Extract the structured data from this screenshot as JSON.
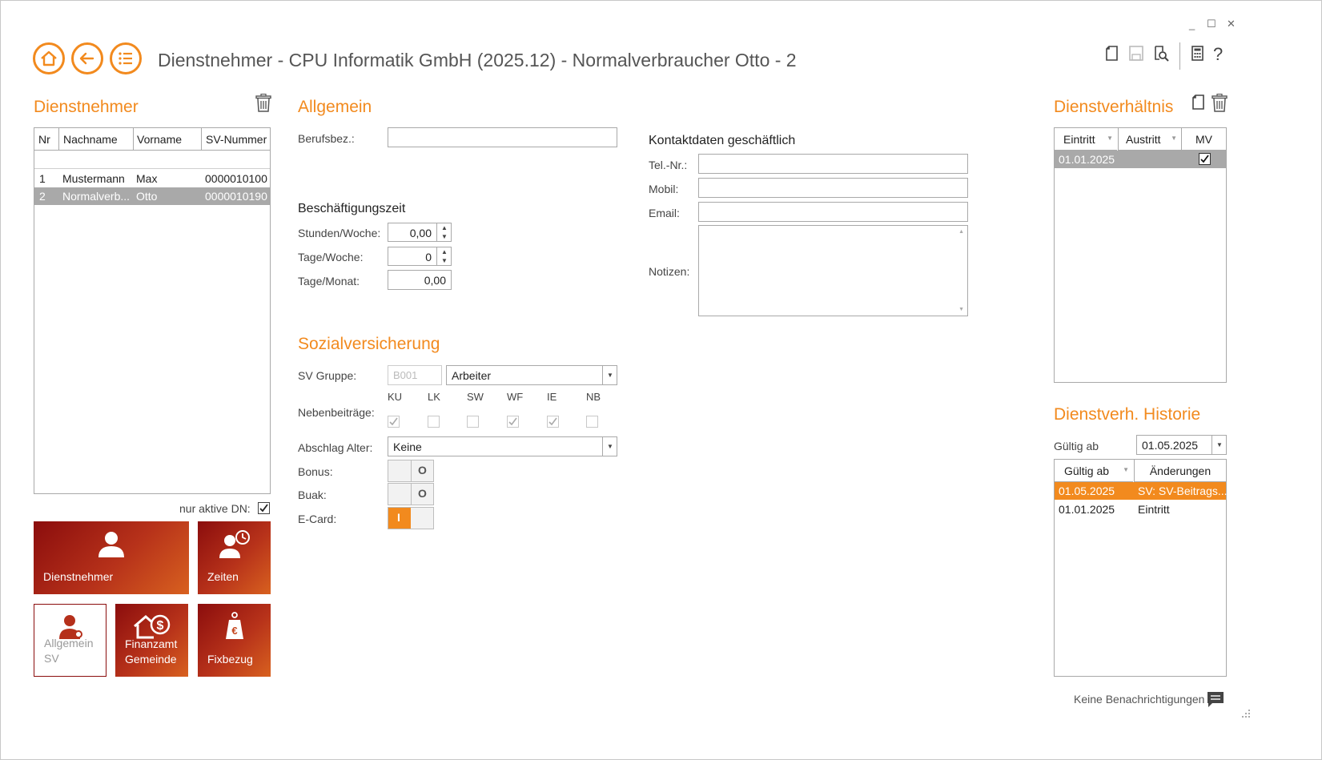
{
  "window": {
    "title": "Dienstnehmer - CPU Informatik GmbH (2025.12) - Normalverbraucher Otto - 2",
    "controls": [
      "_",
      "☐",
      "✕"
    ]
  },
  "toolbar_icons": [
    "new-document-icon",
    "save-icon",
    "search-document-icon",
    "calculator-icon",
    "help-icon"
  ],
  "nav_icons": [
    "home-icon",
    "back-icon",
    "list-icon"
  ],
  "dienstnehmer": {
    "title": "Dienstnehmer",
    "columns": [
      "Nr",
      "Nachname",
      "Vorname",
      "SV-Nummer"
    ],
    "rows": [
      {
        "nr": "1",
        "nachname": "Mustermann",
        "vorname": "Max",
        "sv": "0000010100"
      },
      {
        "nr": "2",
        "nachname": "Normalverb...",
        "vorname": "Otto",
        "sv": "0000010190"
      }
    ],
    "only_active_label": "nur aktive DN:",
    "only_active": true
  },
  "tiles": {
    "dienstnehmer": "Dienstnehmer",
    "zeiten": "Zeiten",
    "allgemein_sv_1": "Allgemein",
    "allgemein_sv_2": "SV",
    "finanzamt_1": "Finanzamt",
    "finanzamt_2": "Gemeinde",
    "fixbezug": "Fixbezug"
  },
  "allgemein": {
    "title": "Allgemein",
    "berufsbez_label": "Berufsbez.:",
    "berufsbez_value": "",
    "beschaeftigung_title": "Beschäftigungszeit",
    "stunden_label": "Stunden/Woche:",
    "stunden_value": "0,00",
    "tage_woche_label": "Tage/Woche:",
    "tage_woche_value": "0",
    "tage_monat_label": "Tage/Monat:",
    "tage_monat_value": "0,00"
  },
  "kontakt": {
    "title": "Kontaktdaten geschäftlich",
    "tel_label": "Tel.-Nr.:",
    "mobil_label": "Mobil:",
    "email_label": "Email:",
    "notizen_label": "Notizen:"
  },
  "sv": {
    "title": "Sozialversicherung",
    "gruppe_label": "SV Gruppe:",
    "gruppe_code": "B001",
    "gruppe_value": "Arbeiter",
    "neben_label": "Nebenbeiträge:",
    "neben_cols": [
      {
        "label": "KU",
        "checked": true
      },
      {
        "label": "LK",
        "checked": false
      },
      {
        "label": "SW",
        "checked": false
      },
      {
        "label": "WF",
        "checked": true
      },
      {
        "label": "IE",
        "checked": true
      },
      {
        "label": "NB",
        "checked": false
      }
    ],
    "abschlag_label": "Abschlag Alter:",
    "abschlag_value": "Keine",
    "bonus_label": "Bonus:",
    "buak_label": "Buak:",
    "ecard_label": "E-Card:",
    "toggle_off_glyph": "O",
    "toggle_on_glyph": "I"
  },
  "dienstverhaeltnis": {
    "title": "Dienstverhältnis",
    "columns": [
      "Eintritt",
      "Austritt",
      "MV"
    ],
    "rows": [
      {
        "eintritt": "01.01.2025",
        "austritt": "",
        "mv": true
      }
    ]
  },
  "historie": {
    "title": "Dienstverh. Historie",
    "gueltig_label": "Gültig ab",
    "gueltig_value": "01.05.2025",
    "columns": [
      "Gültig ab",
      "Änderungen"
    ],
    "rows": [
      {
        "gueltig": "01.05.2025",
        "aenderung": "SV: SV-Beitrags..."
      },
      {
        "gueltig": "01.01.2025",
        "aenderung": "Eintritt"
      }
    ]
  },
  "status": {
    "notifications": "Keine Benachrichtigungen"
  },
  "colors": {
    "accent": "#f28a1e",
    "selected_row": "#a9a9a9",
    "tile_dark": "#8b0d0d"
  }
}
